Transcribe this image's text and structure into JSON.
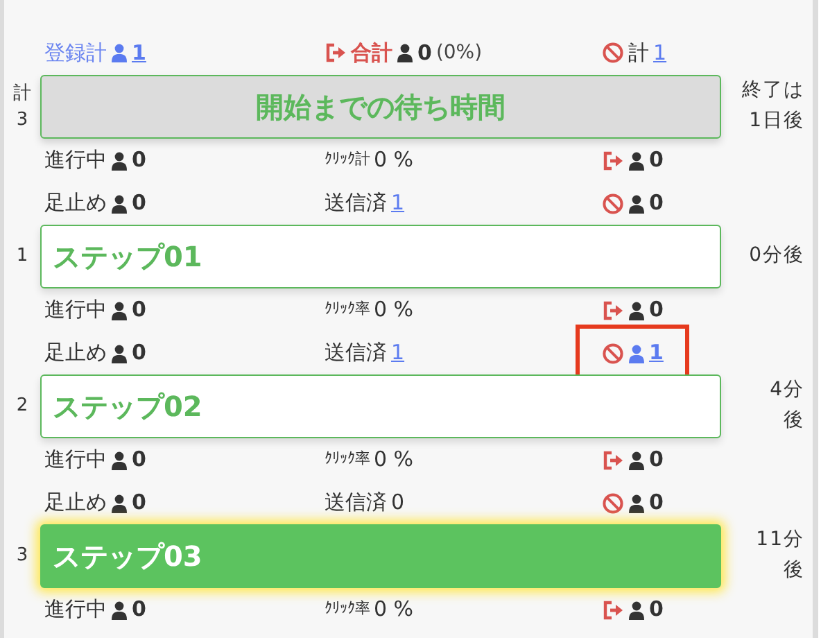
{
  "summary": [
    {
      "kind": "registered",
      "label": "登録計",
      "value": "1",
      "link": true
    },
    {
      "kind": "total_exit",
      "label": "合計",
      "value": "0",
      "suffix": "(0%)",
      "link": false
    },
    {
      "kind": "blocked_total",
      "label": "計",
      "value": "1",
      "link": true
    }
  ],
  "steps": [
    {
      "kind": "waiting",
      "index": "計3",
      "title": "開始までの待ち時間",
      "timing": [
        "終了は",
        "1日後"
      ],
      "stats": [
        [
          {
            "kind": "in_progress",
            "label": "進行中",
            "value": "0",
            "link": false
          },
          {
            "kind": "click",
            "label": "ｸﾘｯｸ計",
            "value": "0 %",
            "link": false
          },
          {
            "kind": "exit",
            "value": "0",
            "link": false
          }
        ],
        [
          {
            "kind": "stuck",
            "label": "足止め",
            "value": "0",
            "link": false
          },
          {
            "kind": "sent",
            "label": "送信済",
            "value": "1",
            "link": true
          },
          {
            "kind": "blocked",
            "value": "0",
            "link": false,
            "highlighted": false
          }
        ]
      ]
    },
    {
      "kind": "step",
      "index": "1",
      "title": "ステップ01",
      "timing": [
        "0分後"
      ],
      "stats": [
        [
          {
            "kind": "in_progress",
            "label": "進行中",
            "value": "0",
            "link": false
          },
          {
            "kind": "click",
            "label": "ｸﾘｯｸ率",
            "value": "0 %",
            "link": false
          },
          {
            "kind": "exit",
            "value": "0",
            "link": false
          }
        ],
        [
          {
            "kind": "stuck",
            "label": "足止め",
            "value": "0",
            "link": false
          },
          {
            "kind": "sent",
            "label": "送信済",
            "value": "1",
            "link": true
          },
          {
            "kind": "blocked",
            "value": "1",
            "link": true,
            "highlighted": true
          }
        ]
      ]
    },
    {
      "kind": "step",
      "index": "2",
      "title": "ステップ02",
      "timing": [
        "4分",
        "後"
      ],
      "stats": [
        [
          {
            "kind": "in_progress",
            "label": "進行中",
            "value": "0",
            "link": false
          },
          {
            "kind": "click",
            "label": "ｸﾘｯｸ率",
            "value": "0 %",
            "link": false
          },
          {
            "kind": "exit",
            "value": "0",
            "link": false
          }
        ],
        [
          {
            "kind": "stuck",
            "label": "足止め",
            "value": "0",
            "link": false
          },
          {
            "kind": "sent",
            "label": "送信済",
            "value": "0",
            "link": false
          },
          {
            "kind": "blocked",
            "value": "0",
            "link": false,
            "highlighted": false
          }
        ]
      ]
    },
    {
      "kind": "current",
      "index": "3",
      "title": "ステップ03",
      "timing": [
        "11分",
        "後"
      ],
      "stats": [
        [
          {
            "kind": "in_progress",
            "label": "進行中",
            "value": "0",
            "link": false
          },
          {
            "kind": "click",
            "label": "ｸﾘｯｸ率",
            "value": "0 %",
            "link": false
          },
          {
            "kind": "exit",
            "value": "0",
            "link": false
          }
        ]
      ]
    }
  ]
}
